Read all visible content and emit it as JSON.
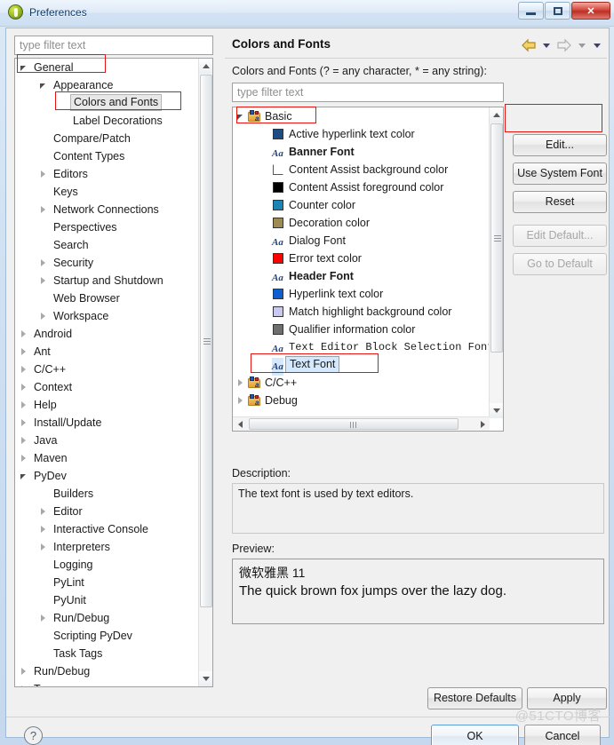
{
  "window": {
    "title": "Preferences",
    "icon": "eclipse-icon",
    "buttons": {
      "minimize": "minimize-icon",
      "maximize": "maximize-icon",
      "close": "✕"
    }
  },
  "left": {
    "filter_placeholder": "type filter text",
    "tree": [
      {
        "label": "General",
        "indent": 0,
        "arrow": "expanded",
        "selected": true
      },
      {
        "label": "Appearance",
        "indent": 1,
        "arrow": "expanded",
        "selected": false
      },
      {
        "label": "Colors and Fonts",
        "indent": 2,
        "arrow": "none",
        "selected": true
      },
      {
        "label": "Label Decorations",
        "indent": 2,
        "arrow": "none",
        "selected": false
      },
      {
        "label": "Compare/Patch",
        "indent": 1,
        "arrow": "none",
        "selected": false
      },
      {
        "label": "Content Types",
        "indent": 1,
        "arrow": "none",
        "selected": false
      },
      {
        "label": "Editors",
        "indent": 1,
        "arrow": "collapsed",
        "selected": false
      },
      {
        "label": "Keys",
        "indent": 1,
        "arrow": "none",
        "selected": false
      },
      {
        "label": "Network Connections",
        "indent": 1,
        "arrow": "collapsed",
        "selected": false
      },
      {
        "label": "Perspectives",
        "indent": 1,
        "arrow": "none",
        "selected": false
      },
      {
        "label": "Search",
        "indent": 1,
        "arrow": "none",
        "selected": false
      },
      {
        "label": "Security",
        "indent": 1,
        "arrow": "collapsed",
        "selected": false
      },
      {
        "label": "Startup and Shutdown",
        "indent": 1,
        "arrow": "collapsed",
        "selected": false
      },
      {
        "label": "Web Browser",
        "indent": 1,
        "arrow": "none",
        "selected": false
      },
      {
        "label": "Workspace",
        "indent": 1,
        "arrow": "collapsed",
        "selected": false
      },
      {
        "label": "Android",
        "indent": 0,
        "arrow": "collapsed",
        "selected": false
      },
      {
        "label": "Ant",
        "indent": 0,
        "arrow": "collapsed",
        "selected": false
      },
      {
        "label": "C/C++",
        "indent": 0,
        "arrow": "collapsed",
        "selected": false
      },
      {
        "label": "Context",
        "indent": 0,
        "arrow": "collapsed",
        "selected": false
      },
      {
        "label": "Help",
        "indent": 0,
        "arrow": "collapsed",
        "selected": false
      },
      {
        "label": "Install/Update",
        "indent": 0,
        "arrow": "collapsed",
        "selected": false
      },
      {
        "label": "Java",
        "indent": 0,
        "arrow": "collapsed",
        "selected": false
      },
      {
        "label": "Maven",
        "indent": 0,
        "arrow": "collapsed",
        "selected": false
      },
      {
        "label": "PyDev",
        "indent": 0,
        "arrow": "expanded",
        "selected": false
      },
      {
        "label": "Builders",
        "indent": 1,
        "arrow": "none",
        "selected": false
      },
      {
        "label": "Editor",
        "indent": 1,
        "arrow": "collapsed",
        "selected": false
      },
      {
        "label": "Interactive Console",
        "indent": 1,
        "arrow": "collapsed",
        "selected": false
      },
      {
        "label": "Interpreters",
        "indent": 1,
        "arrow": "collapsed",
        "selected": false
      },
      {
        "label": "Logging",
        "indent": 1,
        "arrow": "none",
        "selected": false
      },
      {
        "label": "PyLint",
        "indent": 1,
        "arrow": "none",
        "selected": false
      },
      {
        "label": "PyUnit",
        "indent": 1,
        "arrow": "none",
        "selected": false
      },
      {
        "label": "Run/Debug",
        "indent": 1,
        "arrow": "collapsed",
        "selected": false
      },
      {
        "label": "Scripting PyDev",
        "indent": 1,
        "arrow": "none",
        "selected": false
      },
      {
        "label": "Task Tags",
        "indent": 1,
        "arrow": "none",
        "selected": false
      },
      {
        "label": "Run/Debug",
        "indent": 0,
        "arrow": "collapsed",
        "selected": false
      },
      {
        "label": "Team",
        "indent": 0,
        "arrow": "collapsed",
        "selected": false
      }
    ]
  },
  "content": {
    "title": "Colors and Fonts",
    "subtitle": "Colors and Fonts (? = any character, * = any string):",
    "filter_placeholder": "type filter text",
    "nav": {
      "back": "back-arrow-icon",
      "back_menu": "chevron-down-icon",
      "forward": "forward-arrow-icon",
      "forward_menu": "chevron-down-icon",
      "more_menu": "chevron-down-icon"
    },
    "tree": [
      {
        "label": "Basic",
        "kind": "category",
        "arrow": "expanded",
        "indent": 0,
        "selected": false,
        "highlighted": true
      },
      {
        "label": "Active hyperlink text color",
        "kind": "color",
        "color": "#1b4c85",
        "indent": 1,
        "selected": false
      },
      {
        "label": "Banner Font",
        "kind": "font",
        "bold": true,
        "indent": 1,
        "selected": false
      },
      {
        "label": "Content Assist background color",
        "kind": "color",
        "color": "#ffffff",
        "indent": 1,
        "selected": false
      },
      {
        "label": "Content Assist foreground color",
        "kind": "color",
        "color": "#000000",
        "indent": 1,
        "selected": false
      },
      {
        "label": "Counter color",
        "kind": "color",
        "color": "#1a84b5",
        "indent": 1,
        "selected": false
      },
      {
        "label": "Decoration color",
        "kind": "color",
        "color": "#a08a54",
        "indent": 1,
        "selected": false
      },
      {
        "label": "Dialog Font",
        "kind": "font",
        "bold": false,
        "indent": 1,
        "selected": false
      },
      {
        "label": "Error text color",
        "kind": "color",
        "color": "#ff0000",
        "indent": 1,
        "selected": false
      },
      {
        "label": "Header Font",
        "kind": "font",
        "bold": true,
        "indent": 1,
        "selected": false
      },
      {
        "label": "Hyperlink text color",
        "kind": "color",
        "color": "#0d5ed1",
        "indent": 1,
        "selected": false
      },
      {
        "label": "Match highlight background color",
        "kind": "color",
        "color": "#c8c8f0",
        "indent": 1,
        "selected": false
      },
      {
        "label": "Qualifier information color",
        "kind": "color",
        "color": "#6e6e6e",
        "indent": 1,
        "selected": false
      },
      {
        "label": "Text Editor Block Selection Font",
        "kind": "font",
        "mono": true,
        "indent": 1,
        "selected": false
      },
      {
        "label": "Text Font",
        "kind": "font",
        "indent": 1,
        "selected": true,
        "highlighted": true
      },
      {
        "label": "C/C++",
        "kind": "category",
        "arrow": "collapsed",
        "indent": 0,
        "selected": false
      },
      {
        "label": "Debug",
        "kind": "category",
        "arrow": "collapsed",
        "indent": 0,
        "selected": false
      }
    ],
    "side_buttons": [
      {
        "label": "Edit...",
        "enabled": true,
        "highlighted": true
      },
      {
        "label": "Use System Font",
        "enabled": true,
        "highlighted": false
      },
      {
        "label": "Reset",
        "enabled": true,
        "highlighted": false
      },
      {
        "label": "Edit Default...",
        "enabled": false,
        "highlighted": false
      },
      {
        "label": "Go to Default",
        "enabled": false,
        "highlighted": false
      }
    ],
    "description_label": "Description:",
    "description_text": "The text font is used by text editors.",
    "preview_label": "Preview:",
    "preview_font_name": "微软雅黑 11",
    "preview_sample": "The quick brown fox jumps over the lazy dog."
  },
  "footer": {
    "restore_defaults": "Restore Defaults",
    "apply": "Apply",
    "help": "?",
    "ok": "OK",
    "cancel": "Cancel"
  },
  "watermark": "@51CTO博客",
  "colors": {
    "highlight_box": "#e8120f",
    "selection": "#d6e8fb"
  }
}
